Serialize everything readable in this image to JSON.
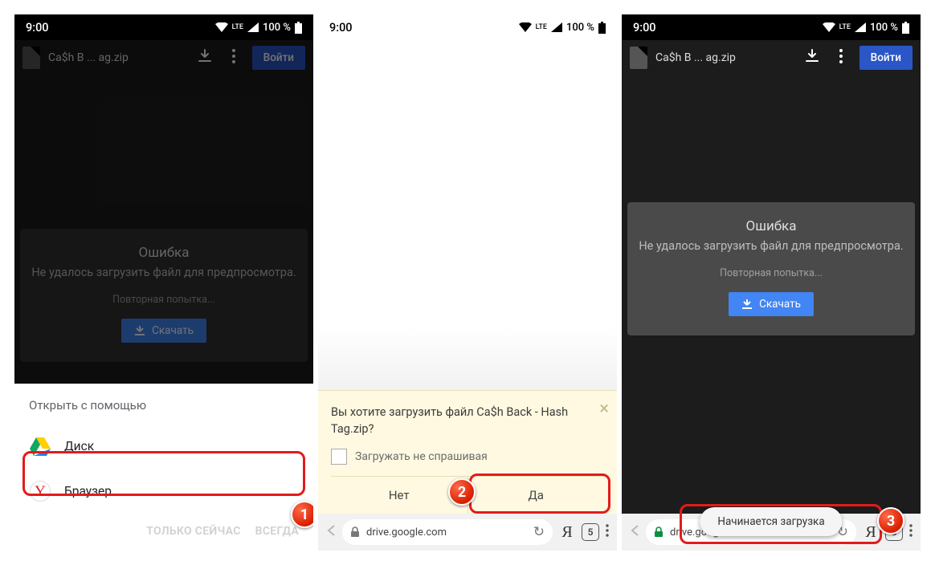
{
  "status": {
    "time": "9:00",
    "lte": "LTE",
    "battery": "100 %"
  },
  "appbar": {
    "filename": "Ca$h B ... ag.zip",
    "login": "Войти"
  },
  "error": {
    "title": "Ошибка",
    "msg": "Не удалось загрузить файл для предпросмотра.",
    "retry": "Повторная попытка...",
    "download": "Скачать"
  },
  "sheet": {
    "title": "Открыть с помощью",
    "items": [
      {
        "label": "Диск"
      },
      {
        "label": "Браузер"
      }
    ],
    "only_now": "ТОЛЬКО СЕЙЧАС",
    "always": "ВСЕГДА"
  },
  "prompt": {
    "text": "Вы хотите загрузить файл Ca$h Back - Hash Tag.zip?",
    "dont_ask": "Загружать не спрашивая",
    "no": "Нет",
    "yes": "Да"
  },
  "browser": {
    "url": "drive.google.com",
    "tabs": "5"
  },
  "toast": "Начинается загрузка",
  "badges": {
    "b1": "1",
    "b2": "2",
    "b3": "3"
  }
}
